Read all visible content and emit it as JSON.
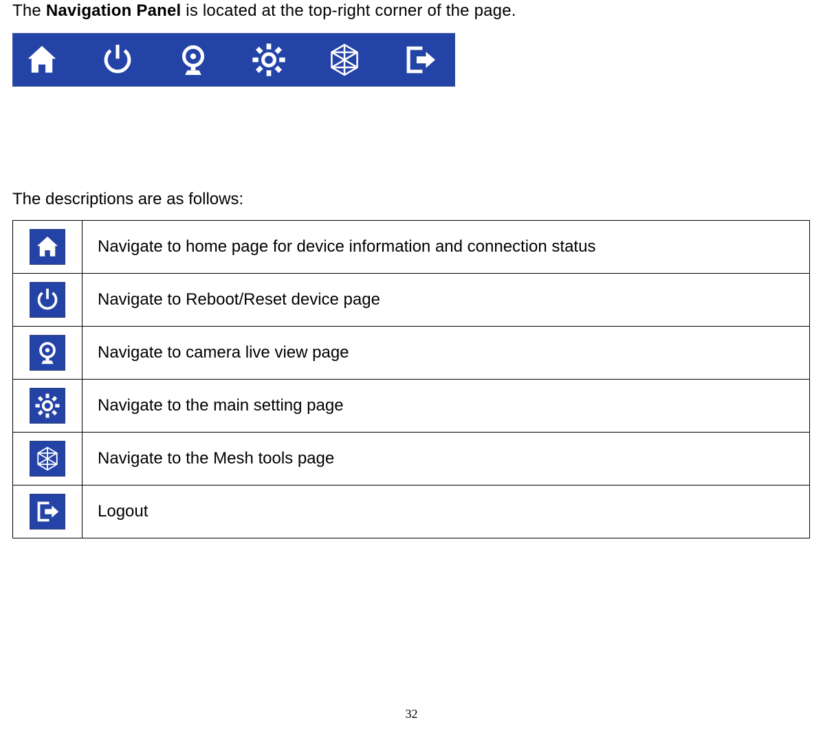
{
  "intro": {
    "prefix": "The ",
    "bold": "Navigation Panel",
    "suffix": " is located at the top-right corner of the page."
  },
  "descriptions_intro": "The descriptions are as follows:",
  "items": [
    {
      "label": "Navigate to home page for device information and connection status"
    },
    {
      "label": "Navigate to Reboot/Reset device page"
    },
    {
      "label": "Navigate to camera live view page"
    },
    {
      "label": "Navigate to the main setting page"
    },
    {
      "label": "Navigate to the Mesh tools page"
    },
    {
      "label": "Logout"
    }
  ],
  "page_number": "32"
}
